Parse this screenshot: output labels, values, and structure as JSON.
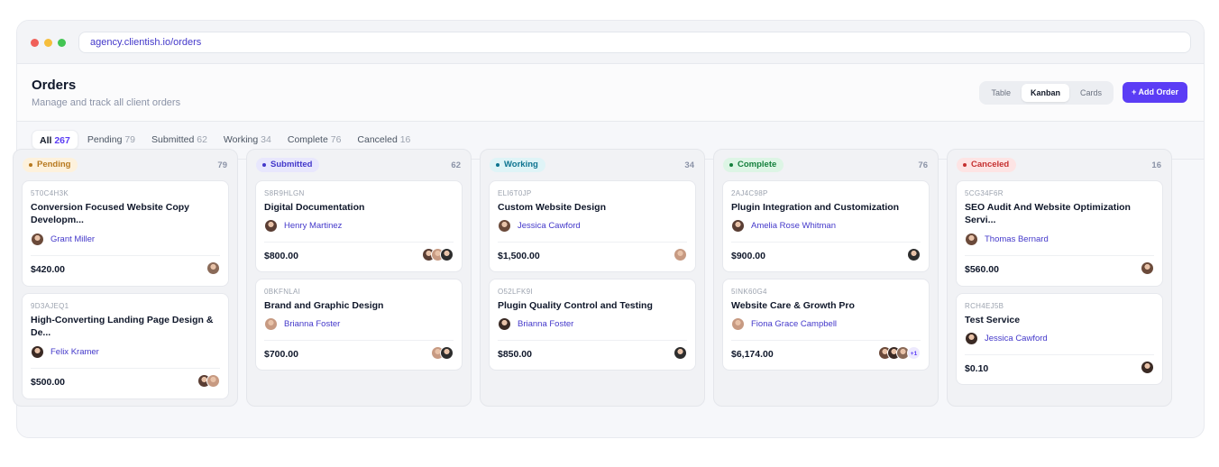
{
  "browser": {
    "url": "agency.clientish.io/orders"
  },
  "header": {
    "title": "Orders",
    "subtitle": "Manage and track all client orders",
    "views": [
      "Table",
      "Kanban",
      "Cards"
    ],
    "active_view": "Kanban",
    "add_button": "+ Add Order"
  },
  "filters": [
    {
      "label": "All",
      "count": "267"
    },
    {
      "label": "Pending",
      "count": "79"
    },
    {
      "label": "Submitted",
      "count": "62"
    },
    {
      "label": "Working",
      "count": "34"
    },
    {
      "label": "Complete",
      "count": "76"
    },
    {
      "label": "Canceled",
      "count": "16"
    }
  ],
  "columns": [
    {
      "status": "Pending",
      "count": "79",
      "pill_bg": "#fdf1dc",
      "pill_fg": "#b7791f",
      "cards": [
        {
          "id": "5T0C4H3K",
          "title": "Conversion Focused Website Copy Developm...",
          "assignee": "Grant Miller",
          "price": "$420.00",
          "avatars": 1,
          "extra": ""
        },
        {
          "id": "9D3AJEQ1",
          "title": "High-Converting Landing Page Design & De...",
          "assignee": "Felix Kramer",
          "price": "$500.00",
          "avatars": 2,
          "extra": ""
        }
      ]
    },
    {
      "status": "Submitted",
      "count": "62",
      "pill_bg": "#e8e7fd",
      "pill_fg": "#4338ca",
      "cards": [
        {
          "id": "S8R9HLGN",
          "title": "Digital Documentation",
          "assignee": "Henry Martinez",
          "price": "$800.00",
          "avatars": 3,
          "extra": ""
        },
        {
          "id": "0BKFNLAI",
          "title": "Brand and Graphic Design",
          "assignee": "Brianna Foster",
          "price": "$700.00",
          "avatars": 2,
          "extra": ""
        }
      ]
    },
    {
      "status": "Working",
      "count": "34",
      "pill_bg": "#dff4f7",
      "pill_fg": "#0e7490",
      "cards": [
        {
          "id": "ELI6T0JP",
          "title": "Custom Website Design",
          "assignee": "Jessica Cawford",
          "price": "$1,500.00",
          "avatars": 1,
          "extra": ""
        },
        {
          "id": "O52LFK9I",
          "title": "Plugin Quality Control and Testing",
          "assignee": "Brianna Foster",
          "price": "$850.00",
          "avatars": 1,
          "extra": ""
        }
      ]
    },
    {
      "status": "Complete",
      "count": "76",
      "pill_bg": "#ddf5e5",
      "pill_fg": "#15803d",
      "cards": [
        {
          "id": "2AJ4C98P",
          "title": "Plugin Integration and Customization",
          "assignee": "Amelia Rose Whitman",
          "price": "$900.00",
          "avatars": 1,
          "extra": ""
        },
        {
          "id": "5INK60G4",
          "title": "Website Care & Growth Pro",
          "assignee": "Fiona Grace Campbell",
          "price": "$6,174.00",
          "avatars": 3,
          "extra": "+1"
        }
      ]
    },
    {
      "status": "Canceled",
      "count": "16",
      "pill_bg": "#fde4e4",
      "pill_fg": "#c53030",
      "cards": [
        {
          "id": "5CG34F6R",
          "title": "SEO Audit And Website Optimization Servi...",
          "assignee": "Thomas Bernard",
          "price": "$560.00",
          "avatars": 1,
          "extra": ""
        },
        {
          "id": "RCH4EJ5B",
          "title": "Test Service",
          "assignee": "Jessica Cawford",
          "price": "$0.10",
          "avatars": 1,
          "extra": ""
        }
      ]
    }
  ]
}
